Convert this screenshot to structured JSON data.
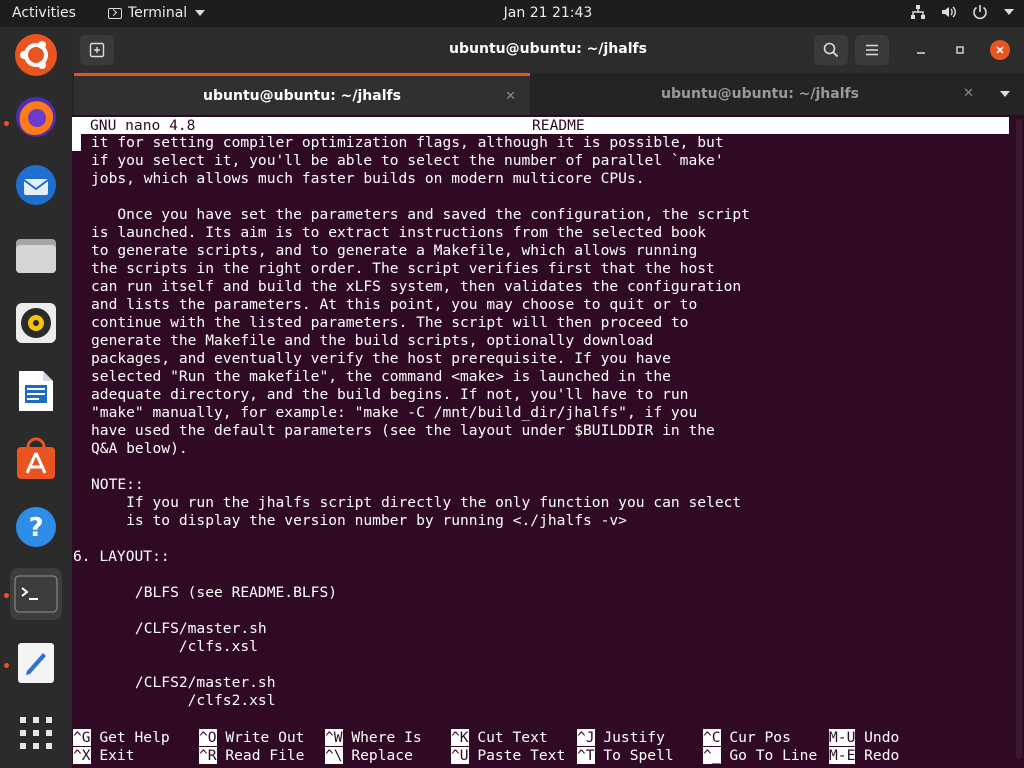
{
  "topbar": {
    "activities": "Activities",
    "app_name": "Terminal",
    "clock": "Jan 21  21:43"
  },
  "window": {
    "title": "ubuntu@ubuntu: ~/jhalfs",
    "tabs": [
      {
        "label": "ubuntu@ubuntu: ~/jhalfs",
        "active": true
      },
      {
        "label": "ubuntu@ubuntu: ~/jhalfs",
        "active": false
      }
    ]
  },
  "nano": {
    "version": "GNU nano 4.8",
    "filename": "README",
    "lines": [
      "it for setting compiler optimization flags, although it is possible, but",
      "if you select it, you'll be able to select the number of parallel `make'",
      "jobs, which allows much faster builds on modern multicore CPUs.",
      "",
      "   Once you have set the parameters and saved the configuration, the script",
      "is launched. Its aim is to extract instructions from the selected book",
      "to generate scripts, and to generate a Makefile, which allows running",
      "the scripts in the right order. The script verifies first that the host",
      "can run itself and build the xLFS system, then validates the configuration",
      "and lists the parameters. At this point, you may choose to quit or to",
      "continue with the listed parameters. The script will then proceed to",
      "generate the Makefile and the build scripts, optionally download",
      "packages, and eventually verify the host prerequisite. If you have",
      "selected \"Run the makefile\", the command <make> is launched in the",
      "adequate directory, and the build begins. If not, you'll have to run",
      "\"make\" manually, for example: \"make -C /mnt/build_dir/jhalfs\", if you",
      "have used the default parameters (see the layout under $BUILDDIR in the",
      "Q&A below).",
      "",
      "NOTE::",
      "    If you run the jhalfs script directly the only function you can select",
      "    is to display the version number by running <./jhalfs -v>",
      "",
      "6. LAYOUT::",
      "",
      "     /BLFS (see README.BLFS)",
      "",
      "     /CLFS/master.sh",
      "          /clfs.xsl",
      "",
      "     /CLFS2/master.sh",
      "           /clfs2.xsl"
    ],
    "shortcuts_row1": [
      {
        "key": "^G",
        "label": "Get Help"
      },
      {
        "key": "^O",
        "label": "Write Out"
      },
      {
        "key": "^W",
        "label": "Where Is"
      },
      {
        "key": "^K",
        "label": "Cut Text"
      },
      {
        "key": "^J",
        "label": "Justify"
      },
      {
        "key": "^C",
        "label": "Cur Pos"
      },
      {
        "key": "M-U",
        "label": "Undo"
      }
    ],
    "shortcuts_row2": [
      {
        "key": "^X",
        "label": "Exit"
      },
      {
        "key": "^R",
        "label": "Read File"
      },
      {
        "key": "^\\",
        "label": "Replace"
      },
      {
        "key": "^U",
        "label": "Paste Text"
      },
      {
        "key": "^T",
        "label": "To Spell"
      },
      {
        "key": "^_",
        "label": "Go To Line"
      },
      {
        "key": "M-E",
        "label": "Redo"
      }
    ]
  },
  "dock": {
    "items": [
      "ubuntu-logo",
      "firefox",
      "thunderbird",
      "files",
      "rhythmbox",
      "libreoffice-writer",
      "software",
      "help",
      "terminal",
      "text-editor"
    ],
    "show_apps": "show-applications-icon"
  },
  "colors": {
    "terminal_bg": "#300a24",
    "accent": "#e95420",
    "topbar_bg": "#1d1d1d",
    "dock_bg": "#2b2b2b"
  }
}
